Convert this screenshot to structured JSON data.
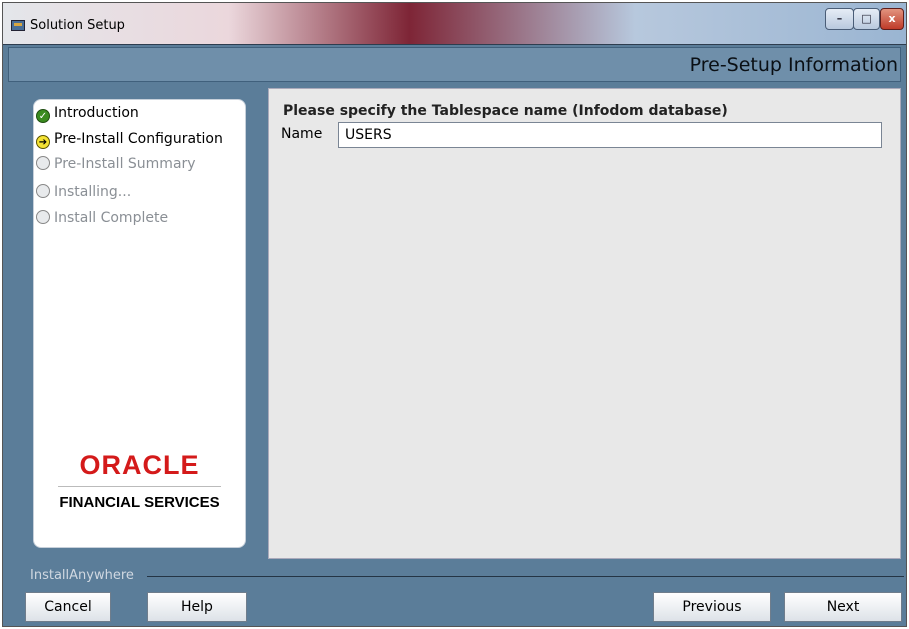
{
  "window": {
    "title": "Solution Setup",
    "minimize_glyph": "–",
    "maximize_glyph": "□",
    "close_glyph": "x"
  },
  "header": {
    "title": "Pre-Setup Information"
  },
  "steps": [
    {
      "label": "Introduction",
      "state": "done",
      "icon": "checkmark-icon"
    },
    {
      "label": "Pre-Install Configuration",
      "state": "current",
      "icon": "arrow-right-icon"
    },
    {
      "label": "Pre-Install Summary",
      "state": "pending",
      "icon": "circle-icon"
    },
    {
      "label": "Installing...",
      "state": "pending",
      "icon": "circle-icon"
    },
    {
      "label": "Install Complete",
      "state": "pending",
      "icon": "circle-icon"
    }
  ],
  "branding": {
    "logo_text": "ORACLE",
    "subtitle": "FINANCIAL SERVICES"
  },
  "form": {
    "prompt": "Please specify the Tablespace name (Infodom database)",
    "name_label": "Name",
    "name_value": "USERS"
  },
  "footer": {
    "vendor_label": "InstallAnywhere",
    "buttons": {
      "cancel": "Cancel",
      "help": "Help",
      "previous": "Previous",
      "next": "Next"
    }
  },
  "colors": {
    "window_bg": "#5b7d99",
    "header_band": "#6f8faa",
    "oracle_red": "#d41a1a",
    "done_green": "#3a8b1f",
    "current_yellow": "#f4e233"
  }
}
